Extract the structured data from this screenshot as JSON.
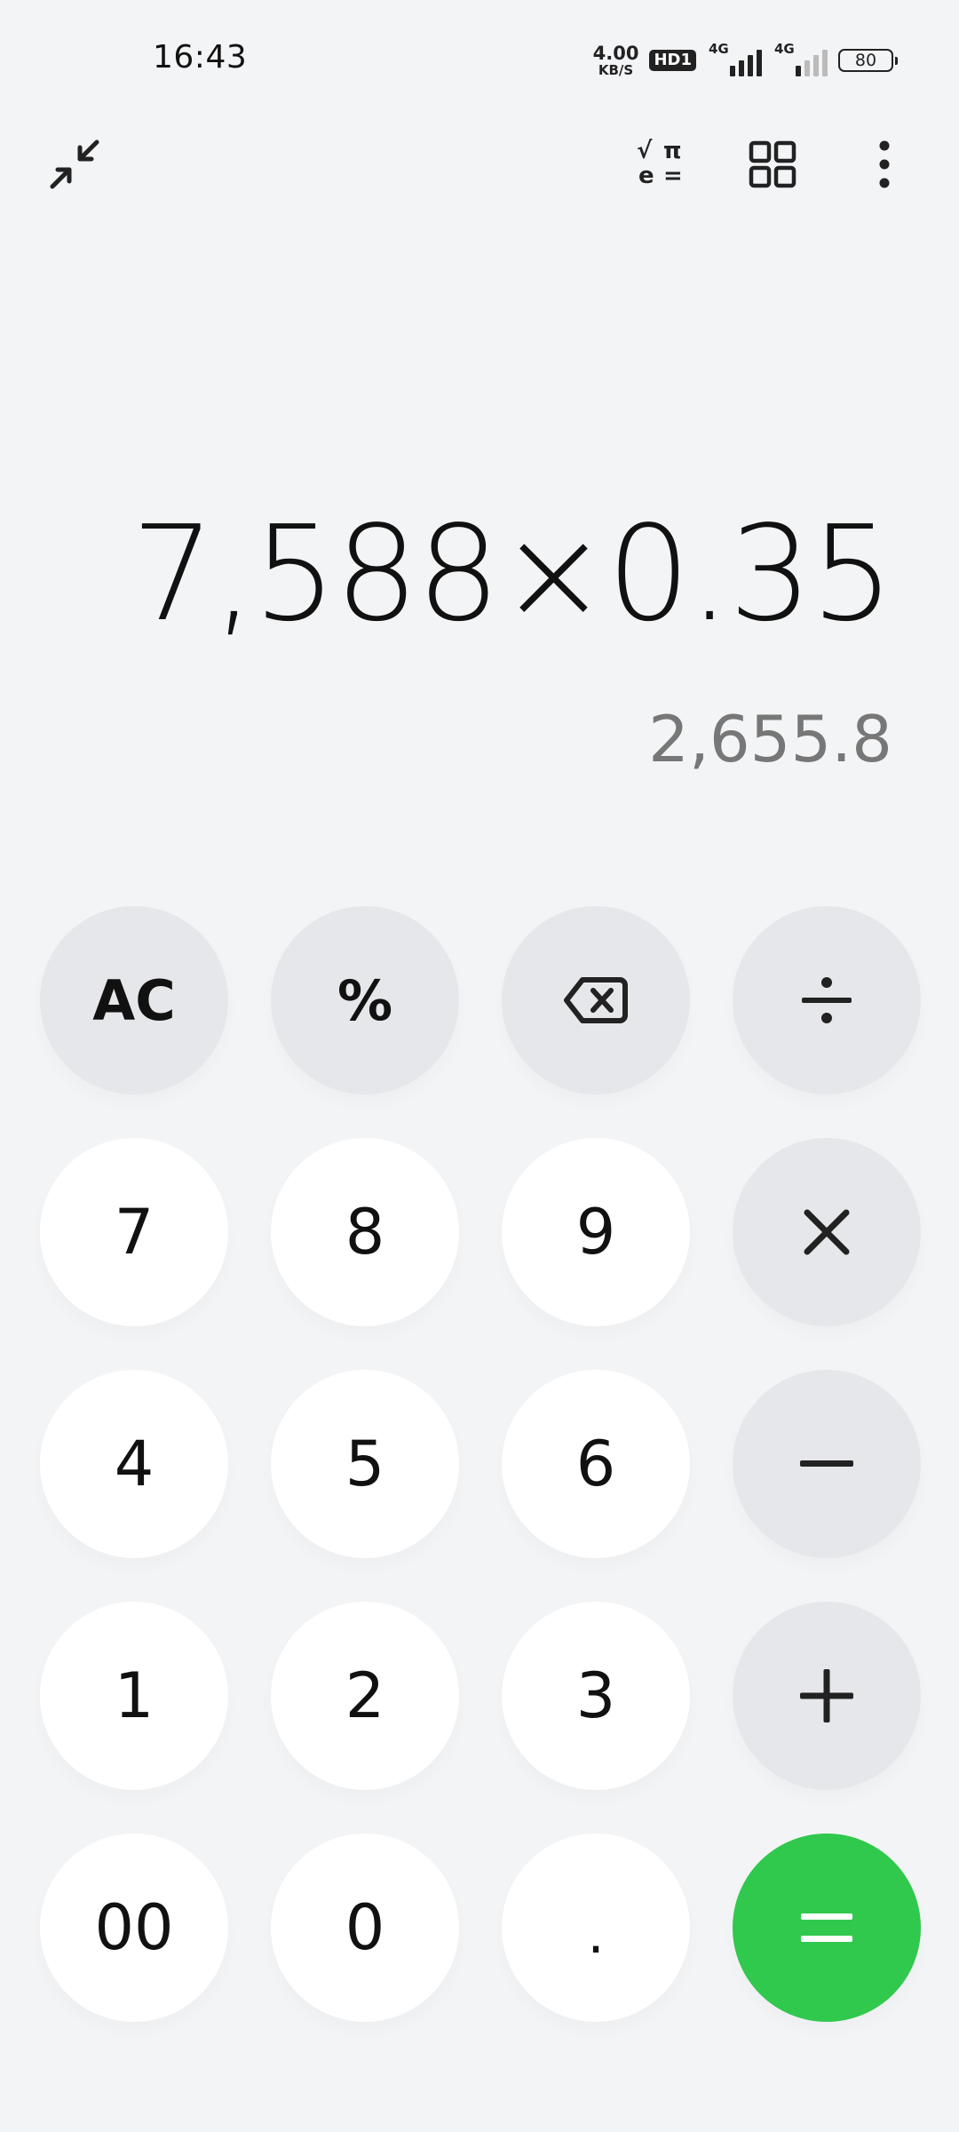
{
  "status_bar": {
    "time": "16:43",
    "net_speed_value": "4.00",
    "net_speed_unit": "KB/S",
    "hd_label": "HD1",
    "sim1_label": "4G",
    "sim2_label": "4G",
    "battery_level": "80"
  },
  "toolbar": {
    "collapse_icon": "collapse-arrows-icon",
    "scientific_icon": "scientific-mode-icon",
    "scientific_glyphs": [
      "√",
      "π",
      "e",
      "="
    ],
    "grid_icon": "grid-icon",
    "more_icon": "more-vertical-icon"
  },
  "display": {
    "expression": "7,588×0.35",
    "result": "2,655.8"
  },
  "keypad": {
    "ac": "AC",
    "percent": "%",
    "backspace_icon": "backspace-icon",
    "divide": "÷",
    "multiply": "×",
    "minus": "−",
    "plus": "+",
    "equals": "=",
    "k7": "7",
    "k8": "8",
    "k9": "9",
    "k4": "4",
    "k5": "5",
    "k6": "6",
    "k1": "1",
    "k2": "2",
    "k3": "3",
    "k00": "00",
    "k0": "0",
    "dot": "."
  },
  "colors": {
    "background": "#f3f4f6",
    "number_key": "#ffffff",
    "function_key": "#e6e7ea",
    "equals_key": "#30c84d",
    "result_text": "#777777"
  }
}
